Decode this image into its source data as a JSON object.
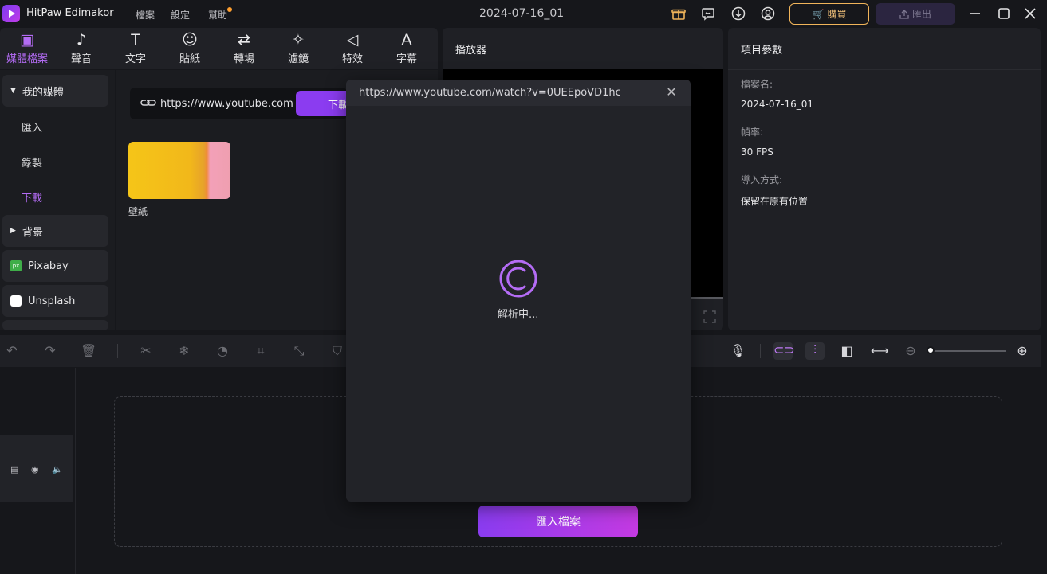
{
  "titlebar": {
    "app_name": "HitPaw Edimakor",
    "menu": [
      "檔案",
      "設定",
      "幫助"
    ],
    "project_title": "2024-07-16_01",
    "buy_label": "購買",
    "export_label": "匯出"
  },
  "tools": [
    {
      "label": "媒體檔案",
      "icon": "media-icon"
    },
    {
      "label": "聲音",
      "icon": "music-note-icon"
    },
    {
      "label": "文字",
      "icon": "text-icon"
    },
    {
      "label": "貼紙",
      "icon": "sticker-icon"
    },
    {
      "label": "轉場",
      "icon": "transition-icon"
    },
    {
      "label": "濾鏡",
      "icon": "filter-sparkle-icon"
    },
    {
      "label": "特效",
      "icon": "effect-icon"
    },
    {
      "label": "字幕",
      "icon": "subtitle-icon"
    }
  ],
  "sidebar": {
    "my_media": "我的媒體",
    "sub": [
      "匯入",
      "錄製",
      "下載"
    ],
    "background": "背景",
    "pixabay": "Pixabay",
    "unsplash": "Unsplash"
  },
  "download": {
    "url_value": "https://www.youtube.com/wa",
    "button_label": "下載"
  },
  "media_items": [
    {
      "label": "壁紙"
    }
  ],
  "player": {
    "title": "播放器"
  },
  "params": {
    "title": "項目參數",
    "file_name_label": "檔案名:",
    "file_name_value": "2024-07-16_01",
    "frame_rate_label": "幀率:",
    "frame_rate_value": "30 FPS",
    "import_method_label": "導入方式:",
    "import_method_value": "保留在原有位置"
  },
  "timeline": {
    "import_button": "匯入檔案"
  },
  "dialog": {
    "url": "https://www.youtube.com/watch?v=0UEEpoVD1hc",
    "status": "解析中..."
  },
  "colors": {
    "accent": "#8b3cf0",
    "accent_light": "#b46cf5",
    "buy_gold": "#f0b45a"
  }
}
